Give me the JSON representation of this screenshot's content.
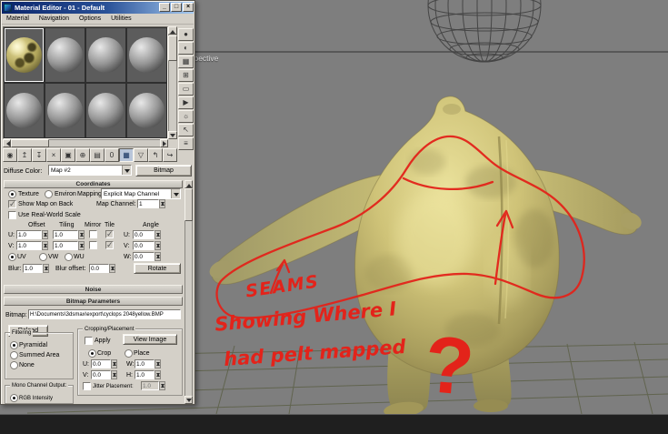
{
  "window": {
    "title": "Material Editor - 01 - Default",
    "menu": [
      "Material",
      "Navigation",
      "Options",
      "Utilities"
    ],
    "buttons": {
      "minimize": "_",
      "maximize": "□",
      "close": "×"
    }
  },
  "material_bar": {
    "diffuse_label": "Diffuse Color:",
    "map_name": "Map #2",
    "map_type": "Bitmap"
  },
  "coordinates": {
    "title": "Coordinates",
    "texture_label": "Texture",
    "environ_label": "Environ",
    "mapping_label": "Mapping:",
    "mapping_value": "Explicit Map Channel",
    "show_map_on_back_label": "Show Map on Back",
    "map_channel_label": "Map Channel:",
    "map_channel_value": "1",
    "use_real_world_label": "Use Real-World Scale",
    "col_offset": "Offset",
    "col_tiling": "Tiling",
    "col_mirror": "Mirror",
    "col_tile": "Tile",
    "col_angle": "Angle",
    "u_label": "U:",
    "v_label": "V:",
    "w_label": "W:",
    "u_offset": "1.0",
    "u_tiling": "1.0",
    "u_angle": "0.0",
    "v_offset": "1.0",
    "v_tiling": "1.0",
    "v_angle": "0.0",
    "w_angle": "0.0",
    "uv_label": "UV",
    "vw_label": "VW",
    "wu_label": "WU",
    "blur_label": "Blur:",
    "blur_value": "1.0",
    "blur_offset_label": "Blur offset:",
    "blur_offset_value": "0.0",
    "rotate_label": "Rotate"
  },
  "noise": {
    "title": "Noise"
  },
  "bitmap_params": {
    "title": "Bitmap Parameters",
    "bitmap_label": "Bitmap:",
    "bitmap_path": "H:\\Documents\\3dsmax\\export\\cyclops 2048yellow.BMP",
    "reload_label": "Reload",
    "cropping_title": "Cropping/Placement",
    "apply_label": "Apply",
    "view_image_label": "View Image",
    "crop_label": "Crop",
    "place_label": "Place",
    "u_label": "U:",
    "v_label": "V:",
    "w_label": "W:",
    "h_label": "H:",
    "u_value": "0.0",
    "v_value": "0.0",
    "w_value": "1.0",
    "h_value": "1.0",
    "jitter_label": "Jitter Placement:",
    "jitter_value": "1.0",
    "filtering_title": "Filtering",
    "filter_pyramidal": "Pyramidal",
    "filter_summed": "Summed Area",
    "filter_none": "None",
    "mono_title": "Mono Channel Output:",
    "mono_rgb": "RGB Intensity"
  },
  "viewport": {
    "label": "Perspective"
  },
  "annotations": {
    "line1": "SEAMS",
    "line2": "Showing Where I",
    "line3": "had pelt mapped",
    "qmark": "?",
    "color": "#e3231a"
  },
  "colors": {
    "chrome": "#d4d0c8",
    "titlebar_start": "#0a246a",
    "titlebar_end": "#a6caf0",
    "viewport_gray": "#7e7e7e",
    "creature_yellow": "#cfc378",
    "annotation_red": "#e3231a"
  },
  "icons": {
    "right_toolbar": [
      {
        "name": "sample-type-icon",
        "glyph": "●"
      },
      {
        "name": "backlight-icon",
        "glyph": "◐"
      },
      {
        "name": "background-icon",
        "glyph": "▦"
      },
      {
        "name": "sample-uv-tiling-icon",
        "glyph": "⊞"
      },
      {
        "name": "video-color-check-icon",
        "glyph": "▭"
      },
      {
        "name": "make-preview-icon",
        "glyph": "▶"
      },
      {
        "name": "options-icon",
        "glyph": "☼"
      },
      {
        "name": "select-by-material-icon",
        "glyph": "↖"
      },
      {
        "name": "material-map-navigator-icon",
        "glyph": "≡"
      }
    ],
    "bottom_toolbar": [
      {
        "name": "get-material-icon",
        "glyph": "◉"
      },
      {
        "name": "put-material-to-scene-icon",
        "glyph": "↥"
      },
      {
        "name": "assign-material-to-selection-icon",
        "glyph": "↧"
      },
      {
        "name": "reset-map-icon",
        "glyph": "×"
      },
      {
        "name": "make-material-copy-icon",
        "glyph": "▣"
      },
      {
        "name": "make-unique-icon",
        "glyph": "⊕"
      },
      {
        "name": "put-to-library-icon",
        "glyph": "▤"
      },
      {
        "name": "material-id-channel-icon",
        "glyph": "0"
      },
      {
        "name": "show-map-in-viewport-icon",
        "glyph": "▦"
      },
      {
        "name": "show-end-result-icon",
        "glyph": "▽"
      },
      {
        "name": "go-to-parent-icon",
        "glyph": "↰"
      },
      {
        "name": "go-forward-sibling-icon",
        "glyph": "↪"
      }
    ]
  }
}
